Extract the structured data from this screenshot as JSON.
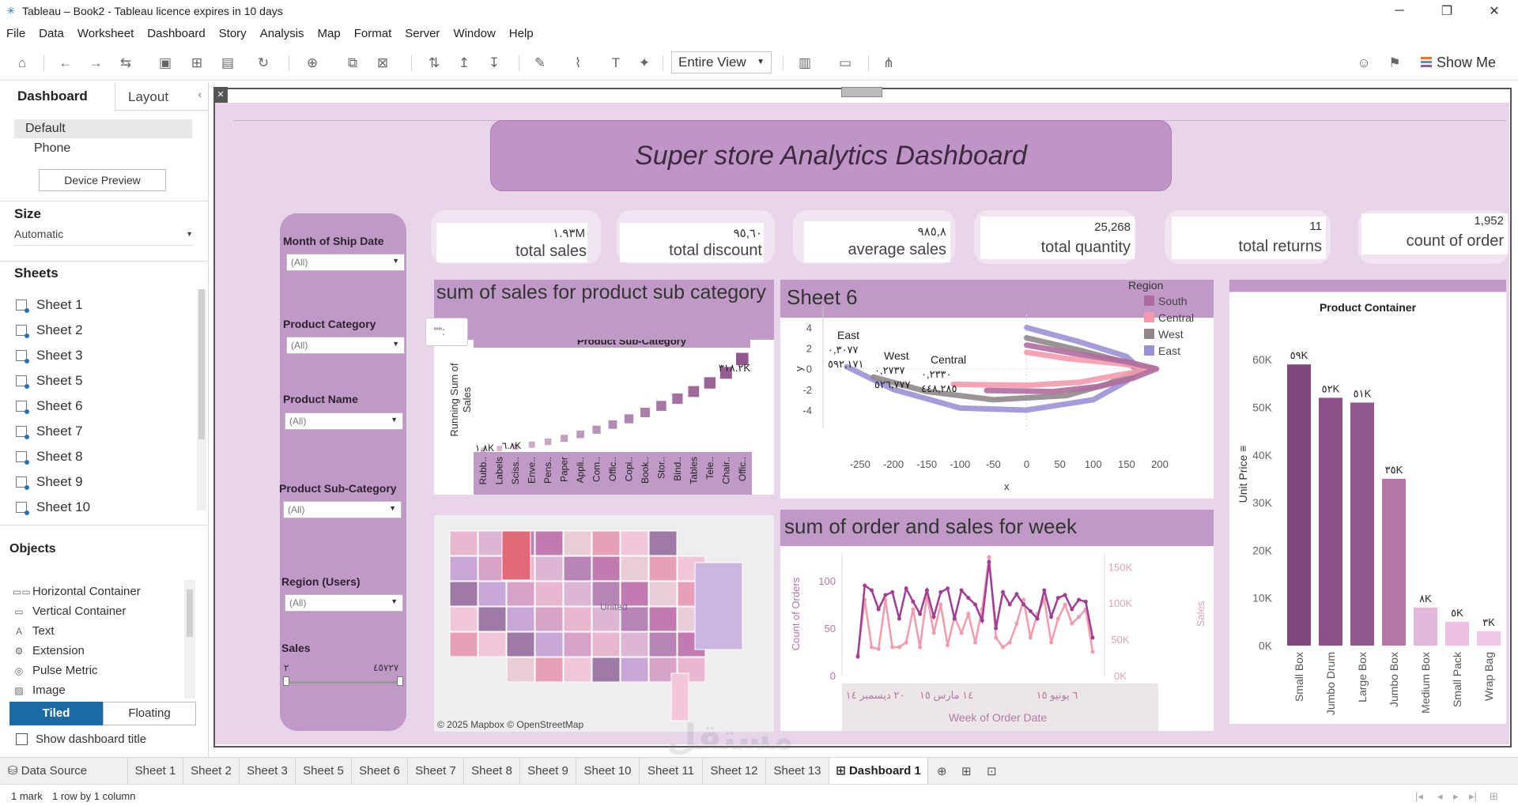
{
  "window": {
    "title": "Tableau – Book2 - Tableau licence expires in 10 days",
    "minimize": "─",
    "restore": "❐",
    "close": "✕"
  },
  "menu": [
    "File",
    "Data",
    "Worksheet",
    "Dashboard",
    "Story",
    "Analysis",
    "Map",
    "Format",
    "Server",
    "Window",
    "Help"
  ],
  "toolbar": {
    "fit_select": "Entire View",
    "show_me": "Show Me"
  },
  "left_panel": {
    "tab_dashboard": "Dashboard",
    "tab_layout": "Layout",
    "device_default": "Default",
    "device_phone": "Phone",
    "device_preview": "Device Preview",
    "size_heading": "Size",
    "size_value": "Automatic",
    "sheets_heading": "Sheets",
    "sheets": [
      "Sheet 1",
      "Sheet 2",
      "Sheet 3",
      "Sheet 5",
      "Sheet 6",
      "Sheet 7",
      "Sheet 8",
      "Sheet 9",
      "Sheet 10"
    ],
    "objects_heading": "Objects",
    "objects": [
      {
        "icon": "▭▭",
        "label": "Horizontal Container"
      },
      {
        "icon": "▭",
        "label": "Vertical Container"
      },
      {
        "icon": "A",
        "label": "Text"
      },
      {
        "icon": "⚙",
        "label": "Extension"
      },
      {
        "icon": "◎",
        "label": "Pulse Metric"
      },
      {
        "icon": "▨",
        "label": "Image"
      }
    ],
    "tiled": "Tiled",
    "floating": "Floating",
    "show_title": "Show dashboard title"
  },
  "dashboard": {
    "title": "Super store Analytics Dashboard",
    "colors": {
      "background": "#e8d5ea",
      "panel": "#c09ac7",
      "title_box": "#bf94c6"
    },
    "filters": [
      {
        "label": "Month of Ship Date",
        "value": "(All)"
      },
      {
        "label": "Product Category",
        "value": "(All)"
      },
      {
        "label": "Product Name",
        "value": "(All)"
      },
      {
        "label": "Product Sub-Category",
        "value": "(All)"
      },
      {
        "label": "Region (Users)",
        "value": "(All)"
      }
    ],
    "sales_filter": {
      "label": "Sales",
      "min": "٢",
      "max": "٤٥٧٢٧"
    },
    "kpis": [
      {
        "value": "١.٩٣M",
        "label": "total sales"
      },
      {
        "value": "٩٥,٦٠",
        "label": "total discount"
      },
      {
        "value": "٩٨٥,٨",
        "label": "average sales"
      },
      {
        "value": "25,268",
        "label": "total quantity"
      },
      {
        "value": "11",
        "label": "total returns"
      },
      {
        "value": "1,952",
        "label": "count of order"
      }
    ],
    "tooltip_stub": "\"\":",
    "map_attribution": "© 2025 Mapbox © OpenStreetMap",
    "map_label": "United"
  },
  "chart_data": [
    {
      "type": "bar",
      "title": "sum of sales for product sub category",
      "header": "Product Sub-Category",
      "ylabel": "Running Sum of Sales",
      "categories": [
        "Rubb..",
        "Labels",
        "Sciss..",
        "Enve..",
        "Pens..",
        "Paper",
        "Appli..",
        "Com..",
        "Offic..",
        "Copi..",
        "Book..",
        "Stor..",
        "Bind..",
        "Tables",
        "Tele..",
        "Chair..",
        "Offic.."
      ],
      "values": [
        1.8,
        6.8,
        12,
        20,
        30,
        42,
        56,
        72,
        90,
        110,
        132,
        155,
        180,
        205,
        235,
        270,
        318.2
      ],
      "labels": {
        "first": "١.٨K",
        "second": "٦.٨K",
        "last": "٣١٨.٢K"
      },
      "color": "#8b4e87"
    },
    {
      "type": "line",
      "title": "Sheet 6",
      "xlabel": "x",
      "ylabel": "y",
      "xticks": [
        "-250",
        "-200",
        "-150",
        "-100",
        "-50",
        "0",
        "50",
        "100",
        "150",
        "200"
      ],
      "yticks": [
        "4",
        "2",
        "0",
        "-2",
        "-4"
      ],
      "xlim": [
        -270,
        200
      ],
      "ylim": [
        -5,
        4.5
      ],
      "legend_title": "Region",
      "series": [
        {
          "name": "South",
          "color": "#b06b9e"
        },
        {
          "name": "Central",
          "color": "#f29bad"
        },
        {
          "name": "West",
          "color": "#908888"
        },
        {
          "name": "East",
          "color": "#9a92d6"
        }
      ],
      "annotations": [
        {
          "name": "East",
          "line1": "٠,٣٠٧٧",
          "line2": "٥٩٢,١٧١"
        },
        {
          "name": "West",
          "line1": "٠,٢٧٣٧",
          "line2": "٥٢٦,٧٧٧"
        },
        {
          "name": "Central",
          "line1": "٠,٢٣٣٠",
          "line2": "٤٤٨,٢٨٥"
        }
      ]
    },
    {
      "type": "line",
      "title": "sum of order and sales for week",
      "xlabel": "Week of Order Date",
      "ylabel_left": "Count of Orders",
      "ylabel_right": "Sales",
      "yticks_left": [
        "100",
        "50",
        "0"
      ],
      "yticks_right": [
        "150K",
        "100K",
        "50K",
        "0K"
      ],
      "xticks": [
        "٢٠ ديسمبر ١٤",
        "١٤ مارس ١٥",
        "٦ يونيو ١٥"
      ],
      "series": [
        {
          "name": "Count of Orders",
          "color": "#a03e92",
          "values": [
            20,
            95,
            90,
            70,
            85,
            88,
            60,
            92,
            78,
            65,
            90,
            62,
            88,
            92,
            60,
            90,
            82,
            75,
            58,
            120,
            50,
            88,
            75,
            86,
            75,
            68,
            60,
            90,
            62,
            82,
            85,
            70,
            80,
            78,
            40
          ]
        },
        {
          "name": "Sales",
          "color": "#f29bad",
          "values": [
            22,
            80,
            30,
            28,
            80,
            30,
            30,
            35,
            70,
            30,
            85,
            45,
            75,
            32,
            62,
            45,
            65,
            35,
            70,
            125,
            40,
            30,
            35,
            55,
            80,
            40,
            65,
            80,
            35,
            60,
            75,
            55,
            62,
            70,
            25
          ]
        }
      ]
    },
    {
      "type": "bar",
      "title": "Product Container",
      "ylabel": "Unit Price ≡",
      "yticks": [
        "60K",
        "50K",
        "40K",
        "30K",
        "20K",
        "10K",
        "0K"
      ],
      "ylim": [
        0,
        65
      ],
      "categories": [
        "Small Box",
        "Jumbo Drum",
        "Large Box",
        "Jumbo Box",
        "Medium Box",
        "Small Pack",
        "Wrap Bag"
      ],
      "values": [
        59,
        52,
        51,
        35,
        8,
        5,
        3
      ],
      "labels": [
        "٥٩K",
        "٥٢K",
        "٥١K",
        "٣٥K",
        "٨K",
        "٥K",
        "٣K"
      ],
      "colors": [
        "#7e4a7d",
        "#8b5288",
        "#8f5a8d",
        "#b576a8",
        "#e4b8dc",
        "#eebfe2",
        "#f0c7e6"
      ]
    }
  ],
  "bottom_tabs": [
    "Data Source",
    "Sheet 1",
    "Sheet 2",
    "Sheet 3",
    "Sheet 5",
    "Sheet 6",
    "Sheet 7",
    "Sheet 8",
    "Sheet 9",
    "Sheet 10",
    "Sheet 11",
    "Sheet 12",
    "Sheet 13",
    "Dashboard 1"
  ],
  "status": {
    "marks": "1 mark",
    "rows": "1 row  by  1 column"
  },
  "watermark": "مستقل"
}
